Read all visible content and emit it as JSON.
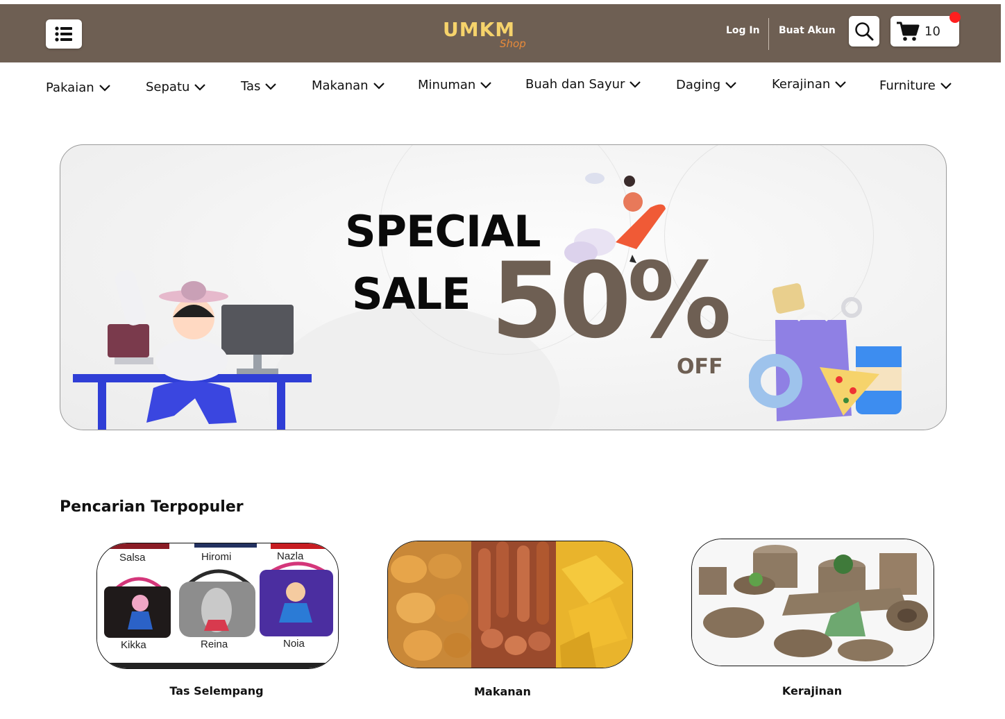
{
  "header": {
    "logo_main": "UMKM",
    "logo_sub": "Shop",
    "login_label": "Log In",
    "signup_label": "Buat Akun",
    "cart_count": "10"
  },
  "nav": {
    "items": [
      {
        "label": "Pakaian"
      },
      {
        "label": "Sepatu"
      },
      {
        "label": "Tas"
      },
      {
        "label": "Makanan"
      },
      {
        "label": "Minuman"
      },
      {
        "label": "Buah dan Sayur"
      },
      {
        "label": "Daging"
      },
      {
        "label": "Kerajinan"
      },
      {
        "label": "Furniture"
      }
    ]
  },
  "banner": {
    "line1": "SPECIAL",
    "line2": "SALE",
    "discount": "50%",
    "off_label": "OFF"
  },
  "popular": {
    "title": "Pencarian Terpopuler",
    "cards": [
      {
        "label": "Tas Selempang",
        "bag_names": [
          "Salsa",
          "Hiromi",
          "Nazla",
          "Kikka",
          "Reina",
          "Noia"
        ]
      },
      {
        "label": "Makanan"
      },
      {
        "label": "Kerajinan"
      }
    ]
  },
  "colors": {
    "brand": "#6e5f53",
    "logo": "#f6d36b",
    "logo_sub": "#e88a3a",
    "badge": "#ff1f1f"
  }
}
